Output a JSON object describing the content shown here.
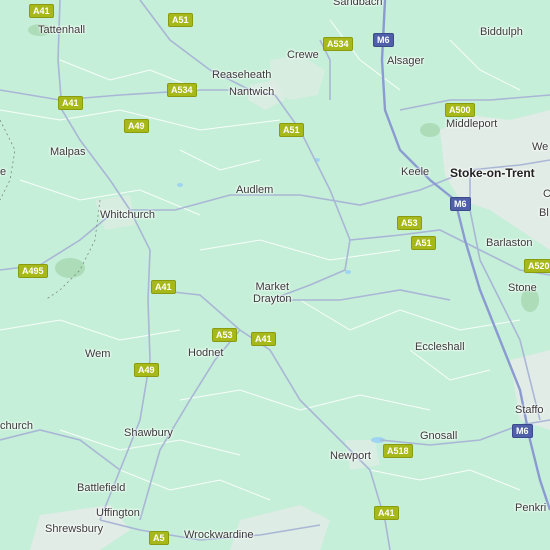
{
  "map": {
    "towns": [
      {
        "id": "tattenhall",
        "label": "Tattenhall"
      },
      {
        "id": "sandbach",
        "label": "Sandbach"
      },
      {
        "id": "biddulph",
        "label": "Biddulph"
      },
      {
        "id": "crewe",
        "label": "Crewe"
      },
      {
        "id": "alsager",
        "label": "Alsager"
      },
      {
        "id": "reaseheath",
        "label": "Reaseheath"
      },
      {
        "id": "nantwich",
        "label": "Nantwich"
      },
      {
        "id": "middleport",
        "label": "Middleport"
      },
      {
        "id": "malpas",
        "label": "Malpas"
      },
      {
        "id": "keele",
        "label": "Keele"
      },
      {
        "id": "stoke",
        "label": "Stoke-on-Trent"
      },
      {
        "id": "audlem",
        "label": "Audlem"
      },
      {
        "id": "whitchurch",
        "label": "Whitchurch"
      },
      {
        "id": "barlaston",
        "label": "Barlaston"
      },
      {
        "id": "market-drayton",
        "label": "Market\nDrayton"
      },
      {
        "id": "stone",
        "label": "Stone"
      },
      {
        "id": "wem",
        "label": "Wem"
      },
      {
        "id": "hodnet",
        "label": "Hodnet"
      },
      {
        "id": "eccleshall",
        "label": "Eccleshall"
      },
      {
        "id": "church",
        "label": "church"
      },
      {
        "id": "shawbury",
        "label": "Shawbury"
      },
      {
        "id": "stafford",
        "label": "Staffo"
      },
      {
        "id": "newport",
        "label": "Newport"
      },
      {
        "id": "gnosall",
        "label": "Gnosall"
      },
      {
        "id": "battlefield",
        "label": "Battlefield"
      },
      {
        "id": "penkridge",
        "label": "Penkri"
      },
      {
        "id": "uffington",
        "label": "Uffington"
      },
      {
        "id": "shrewsbury",
        "label": "Shrewsbury"
      },
      {
        "id": "wrockwardine",
        "label": "Wrockwardine"
      },
      {
        "id": "we-edge",
        "label": "We"
      },
      {
        "id": "e-edge",
        "label": "e"
      },
      {
        "id": "bl-edge",
        "label": "Bl"
      },
      {
        "id": "c-edge",
        "label": "C"
      }
    ],
    "road_shields": [
      {
        "id": "a41-top",
        "label": "A41",
        "kind": "a"
      },
      {
        "id": "a51-top",
        "label": "A51",
        "kind": "a"
      },
      {
        "id": "a534-crewe",
        "label": "A534",
        "kind": "a"
      },
      {
        "id": "m6-north",
        "label": "M6",
        "kind": "m"
      },
      {
        "id": "a534-west",
        "label": "A534",
        "kind": "a"
      },
      {
        "id": "a41-west",
        "label": "A41",
        "kind": "a"
      },
      {
        "id": "a49-north",
        "label": "A49",
        "kind": "a"
      },
      {
        "id": "a51-nantwich",
        "label": "A51",
        "kind": "a"
      },
      {
        "id": "a500",
        "label": "A500",
        "kind": "a"
      },
      {
        "id": "m6-stoke",
        "label": "M6",
        "kind": "m"
      },
      {
        "id": "a53-east",
        "label": "A53",
        "kind": "a"
      },
      {
        "id": "a51-east",
        "label": "A51",
        "kind": "a"
      },
      {
        "id": "a495",
        "label": "A495",
        "kind": "a"
      },
      {
        "id": "a41-mid",
        "label": "A41",
        "kind": "a"
      },
      {
        "id": "a520",
        "label": "A520",
        "kind": "a"
      },
      {
        "id": "a53-mid",
        "label": "A53",
        "kind": "a"
      },
      {
        "id": "a41-drayton",
        "label": "A41",
        "kind": "a"
      },
      {
        "id": "a49-south",
        "label": "A49",
        "kind": "a"
      },
      {
        "id": "m6-south",
        "label": "M6",
        "kind": "m"
      },
      {
        "id": "a518",
        "label": "A518",
        "kind": "a"
      },
      {
        "id": "a41-newport",
        "label": "A41",
        "kind": "a"
      },
      {
        "id": "a5",
        "label": "A5",
        "kind": "a"
      }
    ],
    "colors": {
      "land": "#c5efd8",
      "urban": "#e8ece9",
      "road_major": "#a9b6d6",
      "road_minor": "#ffffff",
      "motorway": "#8b9bd1",
      "water": "#9fd4f2",
      "woodland": "#a8dbb5"
    }
  }
}
